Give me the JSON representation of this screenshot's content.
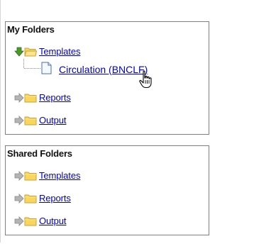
{
  "my_folders": {
    "title": "My Folders",
    "items": [
      {
        "label": "Templates",
        "expanded": true,
        "arrow_color": "#4a9a2a"
      },
      {
        "label": "Reports",
        "expanded": false,
        "arrow_color": "#a0a0a0"
      },
      {
        "label": "Output",
        "expanded": false,
        "arrow_color": "#a0a0a0"
      }
    ],
    "child": {
      "label": "Circulation (BNCLF)"
    }
  },
  "shared_folders": {
    "title": "Shared Folders",
    "items": [
      {
        "label": "Templates"
      },
      {
        "label": "Reports"
      },
      {
        "label": "Output"
      }
    ]
  },
  "colors": {
    "link": "#0000cc",
    "folder_fill": "#f7d65a",
    "folder_edge": "#c9a23a",
    "border": "#808080"
  }
}
